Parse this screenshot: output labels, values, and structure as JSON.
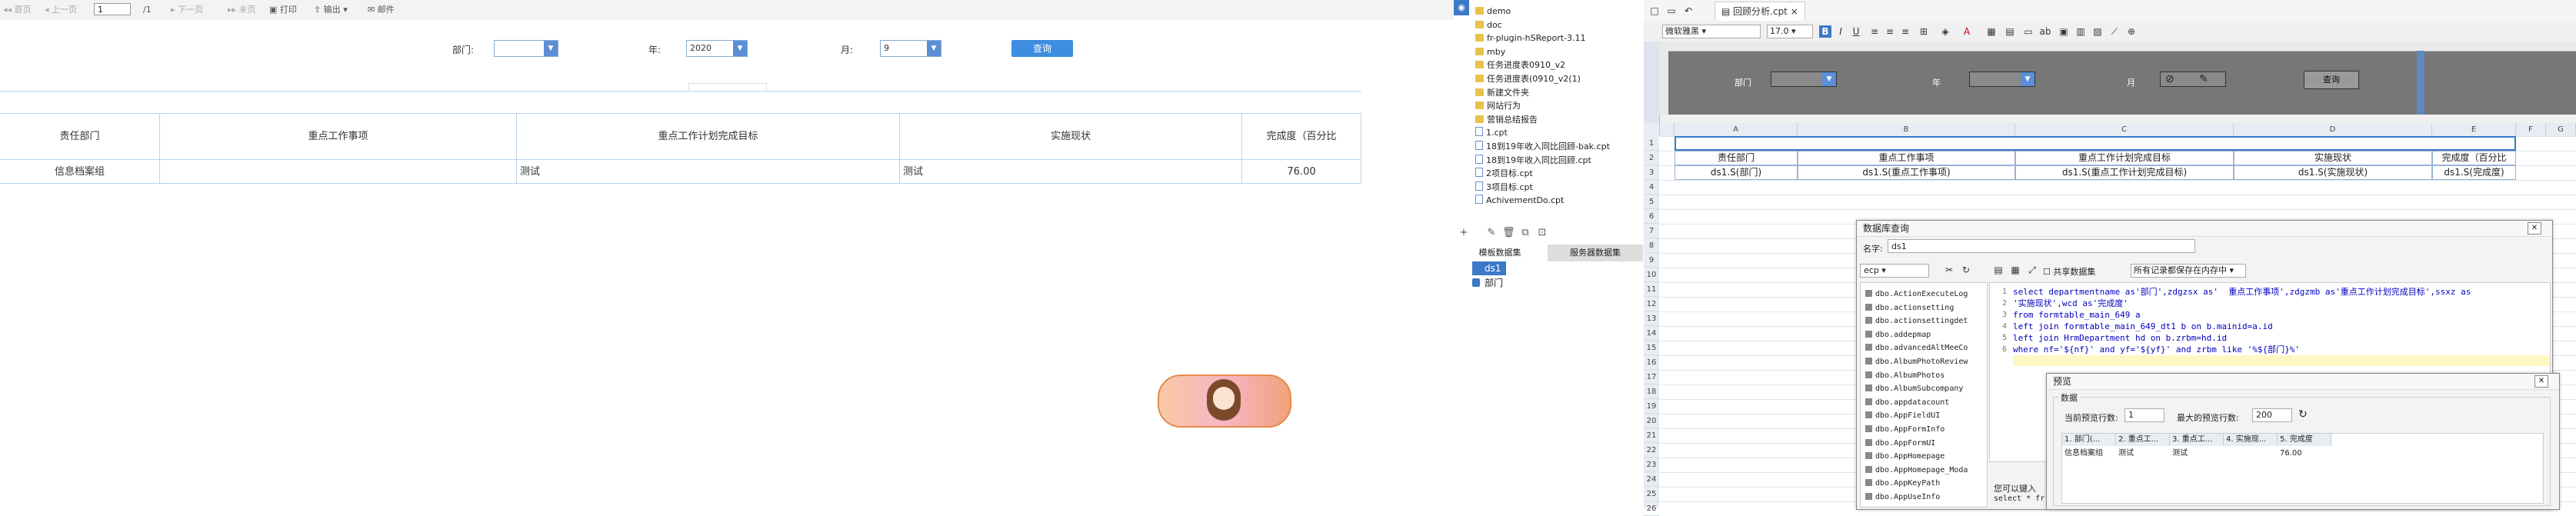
{
  "preview": {
    "toolbar": {
      "first": "首页",
      "prev": "上一页",
      "page_value": "1",
      "page_total": "/1",
      "next": "下一页",
      "last": "末页",
      "print": "打印",
      "export": "输出",
      "mail": "邮件"
    },
    "filters": {
      "dept_label": "部门:",
      "dept_value": "",
      "year_label": "年:",
      "year_value": "2020",
      "month_label": "月:",
      "month_value": "9",
      "query_label": "查询"
    },
    "table": {
      "headers": [
        "责任部门",
        "重点工作事项",
        "重点工作计划完成目标",
        "实施现状",
        "完成度（百分比"
      ],
      "rows": [
        [
          "信息档案组",
          "",
          "测试",
          "测试",
          "76.00"
        ]
      ]
    }
  },
  "designer": {
    "tree": [
      {
        "name": "demo",
        "type": "folder"
      },
      {
        "name": "doc",
        "type": "folder"
      },
      {
        "name": "fr-plugin-hSReport-3.11",
        "type": "folder"
      },
      {
        "name": "mby",
        "type": "folder"
      },
      {
        "name": "任务进度表0910_v2",
        "type": "folder"
      },
      {
        "name": "任务进度表(0910_v2(1)",
        "type": "folder"
      },
      {
        "name": "新建文件夹",
        "type": "folder"
      },
      {
        "name": "网站行为",
        "type": "folder"
      },
      {
        "name": "营销总结报告",
        "type": "folder"
      },
      {
        "name": "1.cpt",
        "type": "file"
      },
      {
        "name": "18到19年收入同比回顾-bak.cpt",
        "type": "file"
      },
      {
        "name": "18到19年收入同比回顾.cpt",
        "type": "file"
      },
      {
        "name": "2项目标.cpt",
        "type": "file"
      },
      {
        "name": "3项目标.cpt",
        "type": "file"
      },
      {
        "name": "AchivementDo.cpt",
        "type": "file"
      }
    ],
    "ds_tabs": {
      "template": "模板数据集",
      "server": "服务器数据集"
    },
    "datasets": [
      "ds1",
      "部门"
    ],
    "doc_tab": "回顾分析.cpt",
    "format": {
      "font": "微软雅黑",
      "size": "17.0"
    },
    "param_labels": {
      "dept": "部门",
      "year": "年",
      "month": "月",
      "query": "查询"
    },
    "columns": [
      "A",
      "B",
      "C",
      "D",
      "E",
      "F",
      "G"
    ],
    "rows": [
      "1",
      "2",
      "3",
      "4",
      "5",
      "6",
      "7",
      "8",
      "9",
      "10",
      "11",
      "12",
      "13",
      "14",
      "15",
      "16",
      "17",
      "18",
      "19",
      "20",
      "21",
      "22",
      "23",
      "24",
      "25",
      "26"
    ],
    "header_cells": [
      "责任部门",
      "重点工作事项",
      "重点工作计划完成目标",
      "实施现状",
      "完成度（百分比"
    ],
    "data_cells": [
      "ds1.S(部门)",
      "ds1.S(重点工作事项)",
      "ds1.S(重点工作计划完成目标)",
      "ds1.S(实施现状)",
      "ds1.S(完成度)"
    ]
  },
  "db_dialog": {
    "title": "数据库查询",
    "name_label": "名字:",
    "name_value": "ds1",
    "connection": "ecp",
    "shared_label": "共享数据集",
    "save_mode": "所有记录都保存在内存中",
    "tables": [
      "dbo.ActionExecuteLog",
      "dbo.actionsetting",
      "dbo.actionsettingdet",
      "dbo.addepmap",
      "dbo.advancedAltMeeCo",
      "dbo.AlbumPhotoReview",
      "dbo.AlbumPhotos",
      "dbo.AlbumSubcompany",
      "dbo.appdatacount",
      "dbo.AppFieldUI",
      "dbo.AppFormInfo",
      "dbo.AppFormUI",
      "dbo.AppHomepage",
      "dbo.AppHomepage_Moda",
      "dbo.AppKeyPath",
      "dbo.AppUseInfo"
    ],
    "sql_lines": [
      "select departmentname as'部门',zdgzsx as'  重点工作事项',zdgzmb as'重点工作计划完成目标',ssxz as",
      "'实施现状',wcd as'完成度'",
      "from formtable_main_649 a",
      "left join formtable_main_649_dt1 b on b.mainid=a.id",
      "left join HrmDepartment hd on b.zrbm=hd.id",
      "where nf='${nf}' and yf='${yf}' and zrbm like '%${部门}%'"
    ],
    "bottom_note": "您可以键入",
    "bottom_note2": "select * fr"
  },
  "preview_dialog": {
    "title": "预览",
    "group": "数据",
    "curr_rows_label": "当前预览行数:",
    "curr_rows_value": "1",
    "max_rows_label": "最大的预览行数:",
    "max_rows_value": "200",
    "headers": [
      "1. 部门(...",
      "2. 重点工...",
      "3. 重点工...",
      "4. 实施现...",
      "5. 完成度"
    ],
    "row": [
      "信息档案组",
      "测试",
      "测试",
      "",
      "76.00"
    ]
  },
  "colors": {
    "accent": "#3d8de0",
    "grid_border": "#b9d4ee",
    "sql_blue": "#0000c0",
    "sql_string": "#c00000"
  }
}
